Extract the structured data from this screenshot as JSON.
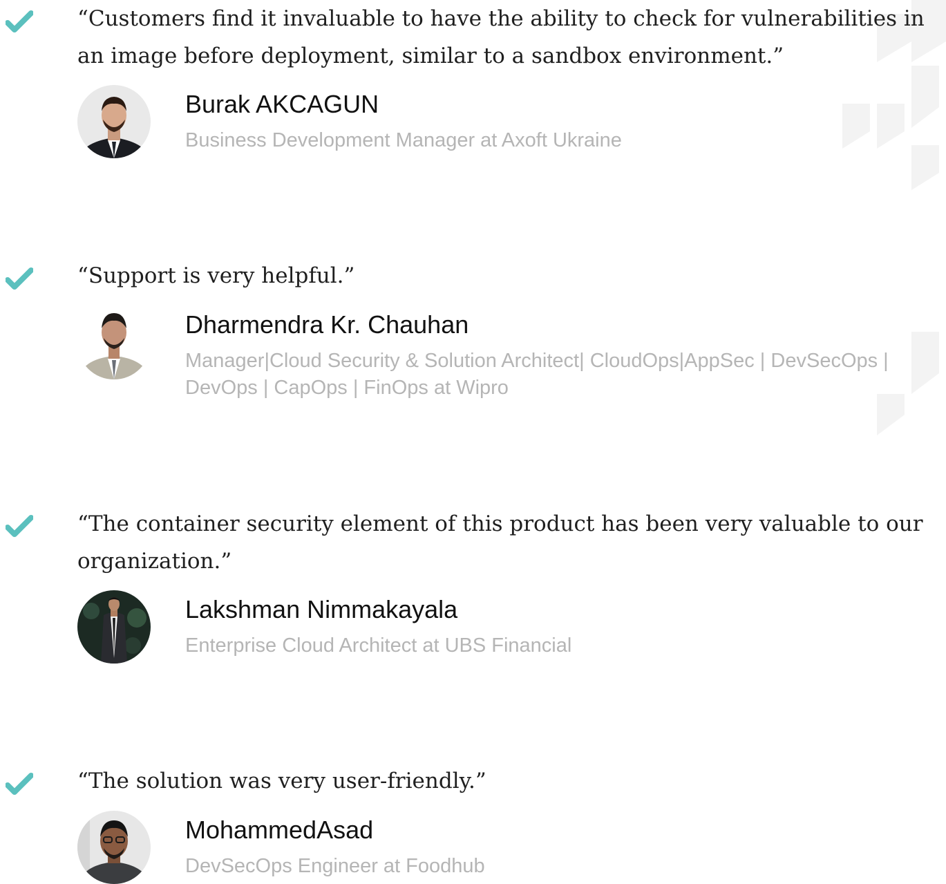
{
  "colors": {
    "check": "#5bc0be",
    "quote_text": "#1f1f1f",
    "name_text": "#111111",
    "role_text": "#b5b5b5",
    "decoration": "#f2f2f2"
  },
  "testimonials": [
    {
      "quote": "“Customers find it invaluable to have the ability to check for vulnerabilities in an image before deployment, similar to a sandbox environment.”",
      "name": "Burak AKCAGUN",
      "role": "Business Development Manager at Axoft Ukraine"
    },
    {
      "quote": "“Support is very helpful.”",
      "name": "Dharmendra Kr. Chauhan",
      "role": "Manager|Cloud Security  & Solution Architect| CloudOps|AppSec | DevSecOps | DevOps | CapOps | FinOps at Wipro"
    },
    {
      "quote": "“The container security element of this product has been very valuable to our organization.”",
      "name": "Lakshman Nimmakayala",
      "role": "Enterprise Cloud Architect at UBS Financial"
    },
    {
      "quote": "“The solution was very user-friendly.”",
      "name": "MohammedAsad",
      "role": "DevSecOps Engineer at Foodhub"
    }
  ],
  "icons": {
    "check": "checkmark-icon",
    "avatar": "avatar-photo",
    "background": "speech-bubble-pattern"
  }
}
